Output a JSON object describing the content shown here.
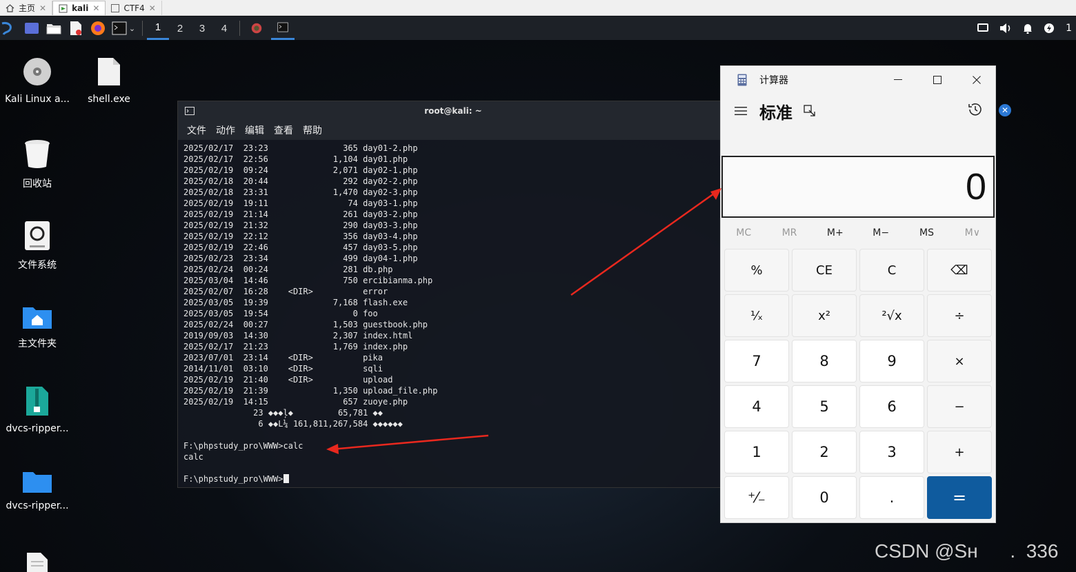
{
  "vm_tabs": [
    {
      "label": "主页"
    },
    {
      "label": "kali"
    },
    {
      "label": "CTF4"
    }
  ],
  "panel": {
    "workspaces": [
      "1",
      "2",
      "3",
      "4"
    ],
    "tray_number": "1"
  },
  "desktop": {
    "icons": [
      {
        "label": "Kali Linux a...",
        "icon": "disc-icon"
      },
      {
        "label": "shell.exe",
        "icon": "file-icon"
      },
      {
        "label": "回收站",
        "icon": "trash-icon"
      },
      {
        "label": "文件系统",
        "icon": "drive-icon"
      },
      {
        "label": "主文件夹",
        "icon": "home-folder-icon"
      },
      {
        "label": "dvcs-ripper...",
        "icon": "archive-icon"
      },
      {
        "label": "dvcs-ripper...",
        "icon": "folder-icon"
      }
    ]
  },
  "terminal": {
    "title": "root@kali: ~",
    "menu": [
      "文件",
      "动作",
      "编辑",
      "查看",
      "帮助"
    ],
    "lines": [
      "2025/02/17  23:23               365 day01-2.php",
      "2025/02/17  22:56             1,104 day01.php",
      "2025/02/19  09:24             2,071 day02-1.php",
      "2025/02/18  20:44               292 day02-2.php",
      "2025/02/18  23:31             1,470 day02-3.php",
      "2025/02/19  19:11                74 day03-1.php",
      "2025/02/19  21:14               261 day03-2.php",
      "2025/02/19  21:32               290 day03-3.php",
      "2025/02/19  22:12               356 day03-4.php",
      "2025/02/19  22:46               457 day03-5.php",
      "2025/02/23  23:34               499 day04-1.php",
      "2025/02/24  00:24               281 db.php",
      "2025/03/04  14:46               750 ercibianma.php",
      "2025/02/07  16:28    <DIR>          error",
      "2025/03/05  19:39             7,168 flash.exe",
      "2025/03/05  19:54                 0 foo",
      "2025/02/24  00:27             1,503 guestbook.php",
      "2019/09/03  14:30             2,307 index.html",
      "2025/02/17  21:23             1,769 index.php",
      "2023/07/01  23:14    <DIR>          pika",
      "2014/11/01  03:10    <DIR>          sqli",
      "2025/02/19  21:40    <DIR>          upload",
      "2025/02/19  21:39             1,350 upload_file.php",
      "2025/02/19  14:15               657 zuoye.php",
      "              23 ◆◆◆ļ◆         65,781 ◆◆",
      "               6 ◆◆L¼ 161,811,267,584 ◆◆◆◆◆◆",
      "",
      "F:\\phpstudy_pro\\WWW>calc",
      "calc",
      ""
    ],
    "prompt": "F:\\phpstudy_pro\\WWW>"
  },
  "calculator": {
    "title": "计算器",
    "mode": "标准",
    "display": "0",
    "memory": [
      {
        "label": "MC",
        "enabled": false
      },
      {
        "label": "MR",
        "enabled": false
      },
      {
        "label": "M+",
        "enabled": true
      },
      {
        "label": "M−",
        "enabled": true
      },
      {
        "label": "MS",
        "enabled": true
      },
      {
        "label": "M∨",
        "enabled": false
      }
    ],
    "keys": [
      {
        "label": "%",
        "kind": "fn",
        "name": "percent-key"
      },
      {
        "label": "CE",
        "kind": "fn",
        "name": "clear-entry-key"
      },
      {
        "label": "C",
        "kind": "fn",
        "name": "clear-key"
      },
      {
        "label": "⌫",
        "kind": "fn",
        "name": "backspace-key"
      },
      {
        "label": "¹⁄ₓ",
        "kind": "fn",
        "name": "reciprocal-key"
      },
      {
        "label": "x²",
        "kind": "fn",
        "name": "square-key"
      },
      {
        "label": "²√x",
        "kind": "fn",
        "name": "sqrt-key"
      },
      {
        "label": "÷",
        "kind": "fn",
        "name": "divide-key"
      },
      {
        "label": "7",
        "kind": "num",
        "name": "digit-7-key"
      },
      {
        "label": "8",
        "kind": "num",
        "name": "digit-8-key"
      },
      {
        "label": "9",
        "kind": "num",
        "name": "digit-9-key"
      },
      {
        "label": "×",
        "kind": "fn",
        "name": "multiply-key"
      },
      {
        "label": "4",
        "kind": "num",
        "name": "digit-4-key"
      },
      {
        "label": "5",
        "kind": "num",
        "name": "digit-5-key"
      },
      {
        "label": "6",
        "kind": "num",
        "name": "digit-6-key"
      },
      {
        "label": "−",
        "kind": "fn",
        "name": "subtract-key"
      },
      {
        "label": "1",
        "kind": "num",
        "name": "digit-1-key"
      },
      {
        "label": "2",
        "kind": "num",
        "name": "digit-2-key"
      },
      {
        "label": "3",
        "kind": "num",
        "name": "digit-3-key"
      },
      {
        "label": "+",
        "kind": "fn",
        "name": "add-key"
      },
      {
        "label": "⁺⁄₋",
        "kind": "num",
        "name": "negate-key"
      },
      {
        "label": "0",
        "kind": "num",
        "name": "digit-0-key"
      },
      {
        "label": ".",
        "kind": "num",
        "name": "decimal-key"
      },
      {
        "label": "=",
        "kind": "eq",
        "name": "equals-key"
      }
    ]
  },
  "watermark": "CSDN @Sн      .  336",
  "colors": {
    "annotation_arrow": "#e8281e",
    "equals_key": "#0f5b9e",
    "panel": "#1d2127",
    "workspace_active": "#3a86d8"
  }
}
